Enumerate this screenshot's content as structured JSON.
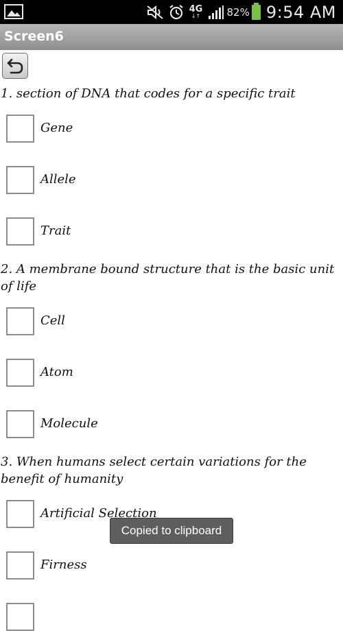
{
  "status_bar": {
    "battery_percent": "82%",
    "time": "9:54 AM",
    "network": "4G",
    "icons": [
      "gallery-icon",
      "mute-icon",
      "alarm-icon",
      "signal-icon",
      "battery-icon"
    ]
  },
  "title_bar": {
    "title": "Screen6"
  },
  "back_button": {
    "icon": "back-arrow-icon"
  },
  "questions": [
    {
      "text": "1. section of DNA that codes for a specific trait",
      "options": [
        "Gene",
        "Allele",
        "Trait"
      ]
    },
    {
      "text": "2. A membrane bound structure that is the basic unit of life",
      "options": [
        "Cell",
        "Atom",
        "Molecule"
      ]
    },
    {
      "text": "3. When humans select certain variations for the benefit of humanity",
      "options": [
        "Artificial Selection",
        "Firness"
      ]
    }
  ],
  "toast": {
    "text": "Copied to clipboard"
  },
  "colors": {
    "status_bar": "#000000",
    "title_bar": "#a3a3a3",
    "battery": "#7ac143",
    "toast": "#525252"
  }
}
